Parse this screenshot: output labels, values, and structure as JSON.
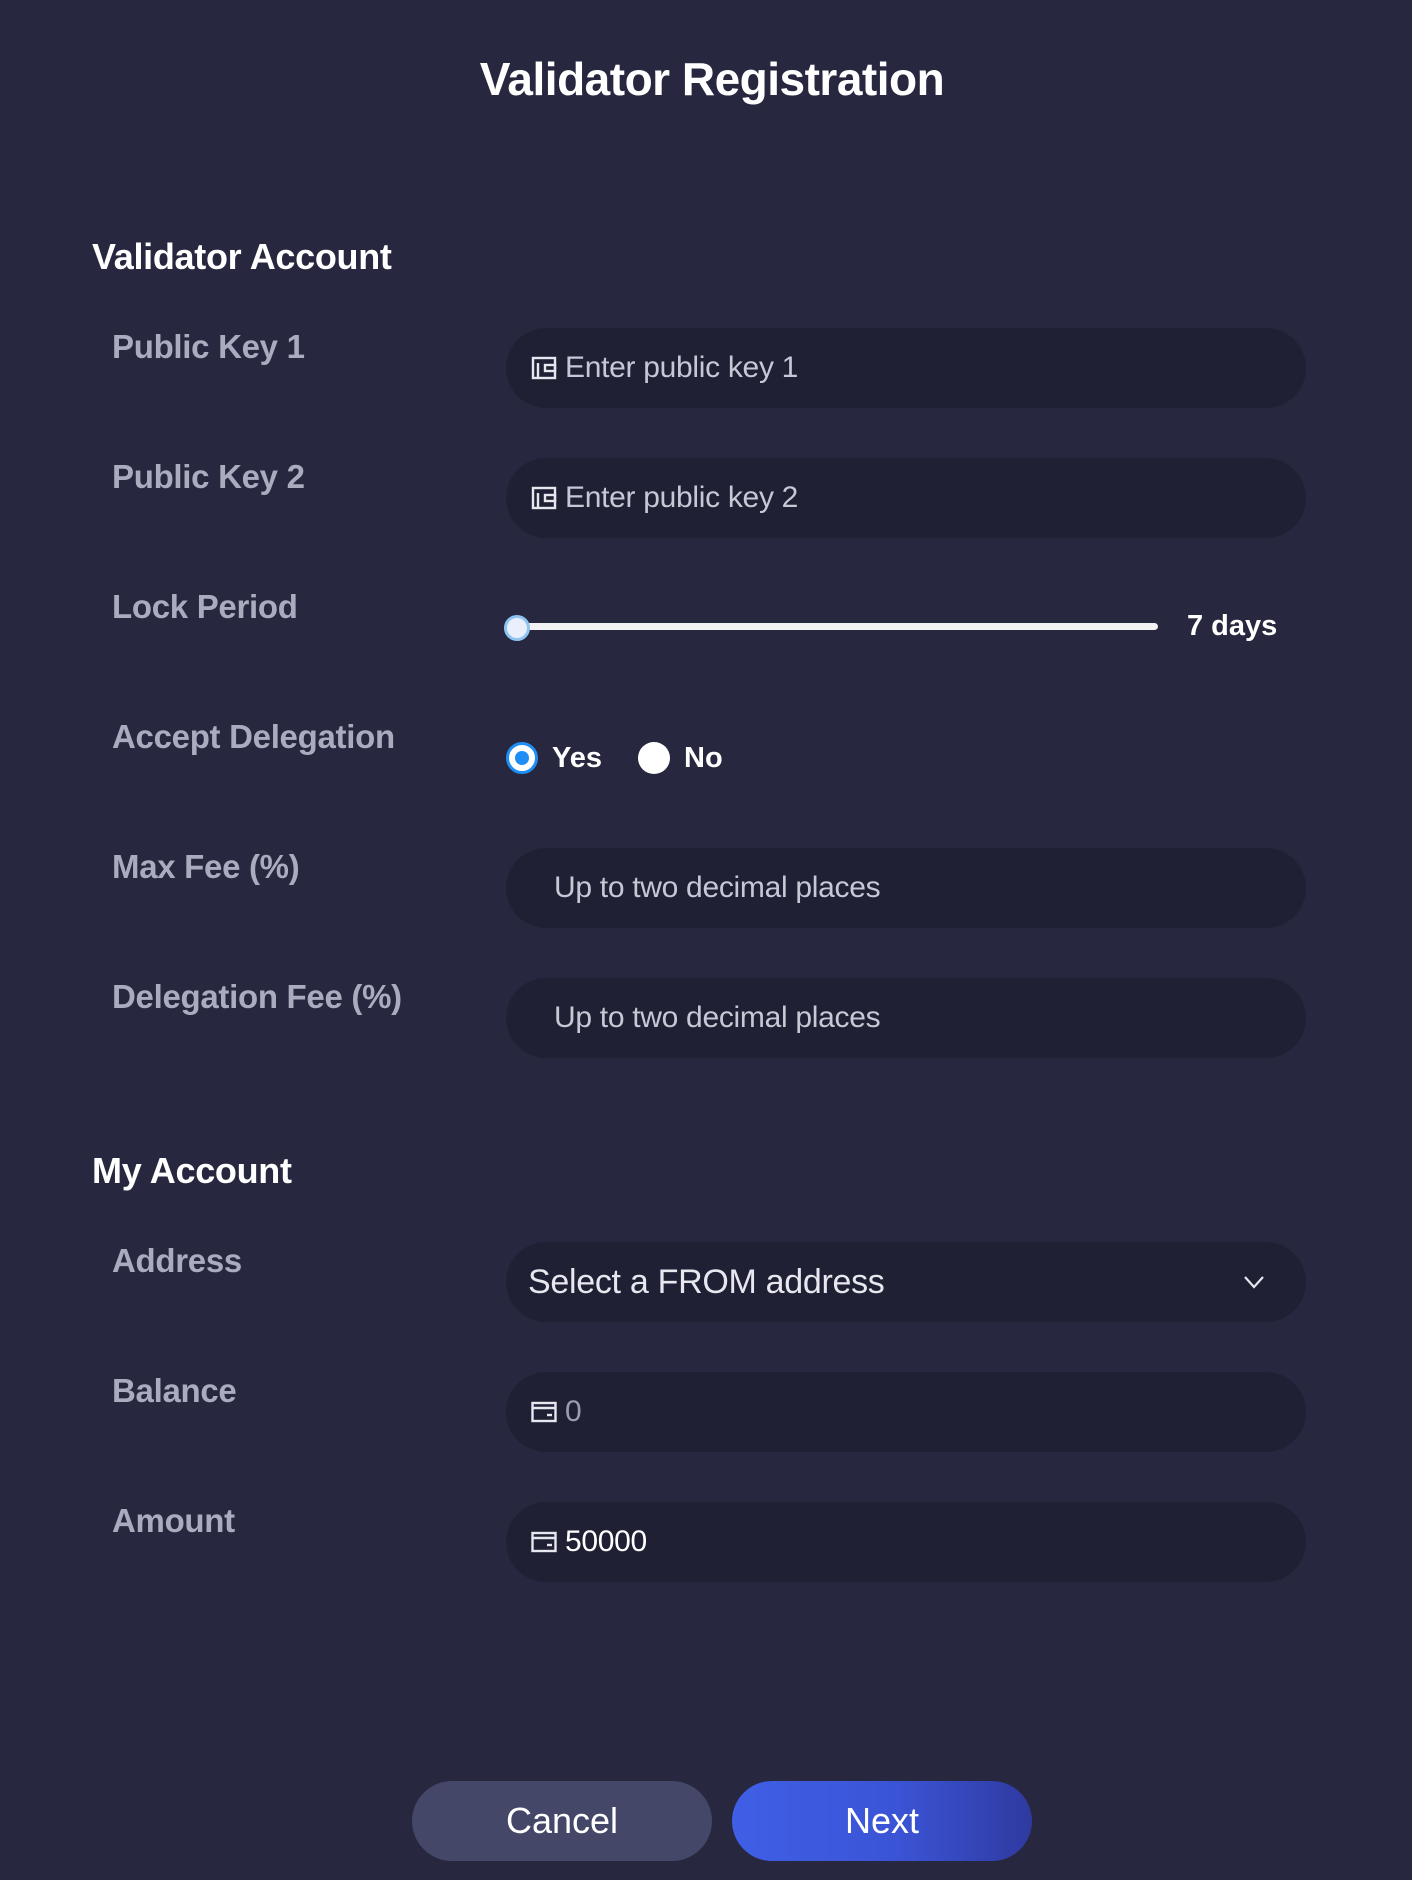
{
  "title": "Validator Registration",
  "validator_account": {
    "heading": "Validator Account",
    "public_key_1": {
      "label": "Public Key 1",
      "placeholder": "Enter public key 1",
      "icon": "wallet-icon"
    },
    "public_key_2": {
      "label": "Public Key 2",
      "placeholder": "Enter public key 2",
      "icon": "wallet-icon"
    },
    "lock_period": {
      "label": "Lock Period",
      "value_text": "7 days",
      "slider_fraction": 0.0
    },
    "accept_delegation": {
      "label": "Accept Delegation",
      "options": [
        {
          "label": "Yes",
          "checked": true
        },
        {
          "label": "No",
          "checked": false
        }
      ]
    },
    "max_fee": {
      "label": "Max Fee (%)",
      "placeholder": "Up to two decimal places"
    },
    "delegation_fee": {
      "label": "Delegation Fee (%)",
      "placeholder": "Up to two decimal places"
    }
  },
  "my_account": {
    "heading": "My Account",
    "address": {
      "label": "Address",
      "placeholder": "Select a FROM address",
      "icon": "chevron-down-icon"
    },
    "balance": {
      "label": "Balance",
      "value": "0",
      "icon": "card-icon"
    },
    "amount": {
      "label": "Amount",
      "value": "50000",
      "icon": "card-icon"
    }
  },
  "buttons": {
    "cancel": "Cancel",
    "next": "Next"
  },
  "colors": {
    "background": "#27283f",
    "field": "#1f2033",
    "label": "#a9abbe",
    "radio_accent": "#1f8ef4",
    "cancel_button": "#444767",
    "next_button": "#3f5fe6"
  }
}
